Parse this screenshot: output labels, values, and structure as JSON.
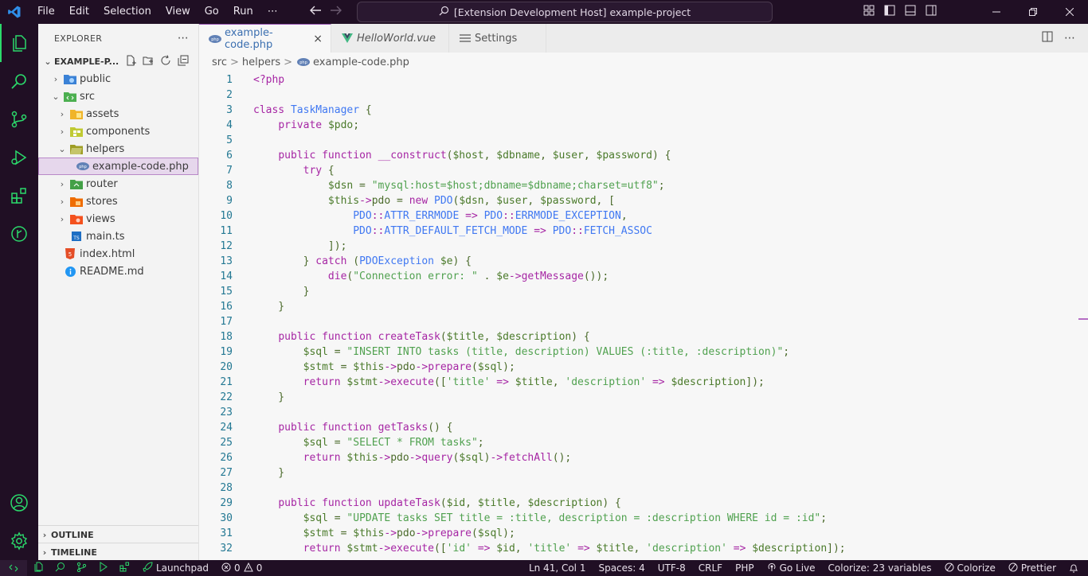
{
  "titlebar": {
    "menu": [
      "File",
      "Edit",
      "Selection",
      "View",
      "Go",
      "Run",
      "⋯"
    ],
    "command_center": "[Extension Development Host] example-project"
  },
  "sidebar": {
    "title": "EXPLORER",
    "more": "⋯",
    "folder": "EXAMPLE-P...",
    "tree": {
      "public": "public",
      "src": "src",
      "assets": "assets",
      "components": "components",
      "helpers": "helpers",
      "example": "example-code.php",
      "router": "router",
      "stores": "stores",
      "views": "views",
      "main": "main.ts",
      "index": "index.html",
      "readme": "README.md"
    },
    "outline": "OUTLINE",
    "timeline": "TIMELINE"
  },
  "tabs": {
    "php": "example-code.php",
    "vue": "HelloWorld.vue",
    "settings": "Settings",
    "close": "×"
  },
  "breadcrumb": {
    "seg1": "src",
    "seg2": "helpers",
    "seg3": "example-code.php",
    "sep": ">"
  },
  "code_lines": [
    {
      "n": "1",
      "t": "<?php"
    },
    {
      "n": "2",
      "t": ""
    },
    {
      "n": "3",
      "t": "class TaskManager {"
    },
    {
      "n": "4",
      "t": "    private $pdo;"
    },
    {
      "n": "5",
      "t": ""
    },
    {
      "n": "6",
      "t": "    public function __construct($host, $dbname, $user, $password) {"
    },
    {
      "n": "7",
      "t": "        try {"
    },
    {
      "n": "8",
      "t": "            $dsn = \"mysql:host=$host;dbname=$dbname;charset=utf8\";"
    },
    {
      "n": "9",
      "t": "            $this->pdo = new PDO($dsn, $user, $password, ["
    },
    {
      "n": "10",
      "t": "                PDO::ATTR_ERRMODE => PDO::ERRMODE_EXCEPTION,"
    },
    {
      "n": "11",
      "t": "                PDO::ATTR_DEFAULT_FETCH_MODE => PDO::FETCH_ASSOC"
    },
    {
      "n": "12",
      "t": "            ]);"
    },
    {
      "n": "13",
      "t": "        } catch (PDOException $e) {"
    },
    {
      "n": "14",
      "t": "            die(\"Connection error: \" . $e->getMessage());"
    },
    {
      "n": "15",
      "t": "        }"
    },
    {
      "n": "16",
      "t": "    }"
    },
    {
      "n": "17",
      "t": ""
    },
    {
      "n": "18",
      "t": "    public function createTask($title, $description) {"
    },
    {
      "n": "19",
      "t": "        $sql = \"INSERT INTO tasks (title, description) VALUES (:title, :description)\";"
    },
    {
      "n": "20",
      "t": "        $stmt = $this->pdo->prepare($sql);"
    },
    {
      "n": "21",
      "t": "        return $stmt->execute(['title' => $title, 'description' => $description]);"
    },
    {
      "n": "22",
      "t": "    }"
    },
    {
      "n": "23",
      "t": ""
    },
    {
      "n": "24",
      "t": "    public function getTasks() {"
    },
    {
      "n": "25",
      "t": "        $sql = \"SELECT * FROM tasks\";"
    },
    {
      "n": "26",
      "t": "        return $this->pdo->query($sql)->fetchAll();"
    },
    {
      "n": "27",
      "t": "    }"
    },
    {
      "n": "28",
      "t": ""
    },
    {
      "n": "29",
      "t": "    public function updateTask($id, $title, $description) {"
    },
    {
      "n": "30",
      "t": "        $sql = \"UPDATE tasks SET title = :title, description = :description WHERE id = :id\";"
    },
    {
      "n": "31",
      "t": "        $stmt = $this->pdo->prepare($sql);"
    },
    {
      "n": "32",
      "t": "        return $stmt->execute(['id' => $id, 'title' => $title, 'description' => $description]);"
    }
  ],
  "statusbar": {
    "launchpad": "Launchpad",
    "errors": "0",
    "warnings": "0",
    "position": "Ln 41, Col 1",
    "spaces": "Spaces: 4",
    "encoding": "UTF-8",
    "eol": "CRLF",
    "language": "PHP",
    "golive": "Go Live",
    "colorize_vars": "Colorize: 23 variables",
    "colorize": "Colorize",
    "prettier": "Prettier"
  },
  "colors": {
    "accent": "#2bd96b",
    "chrome": "#200f24",
    "keyword": "#a626a4",
    "string": "#50a14f",
    "variable": "#4a7a2a",
    "class": "#4078f2"
  }
}
